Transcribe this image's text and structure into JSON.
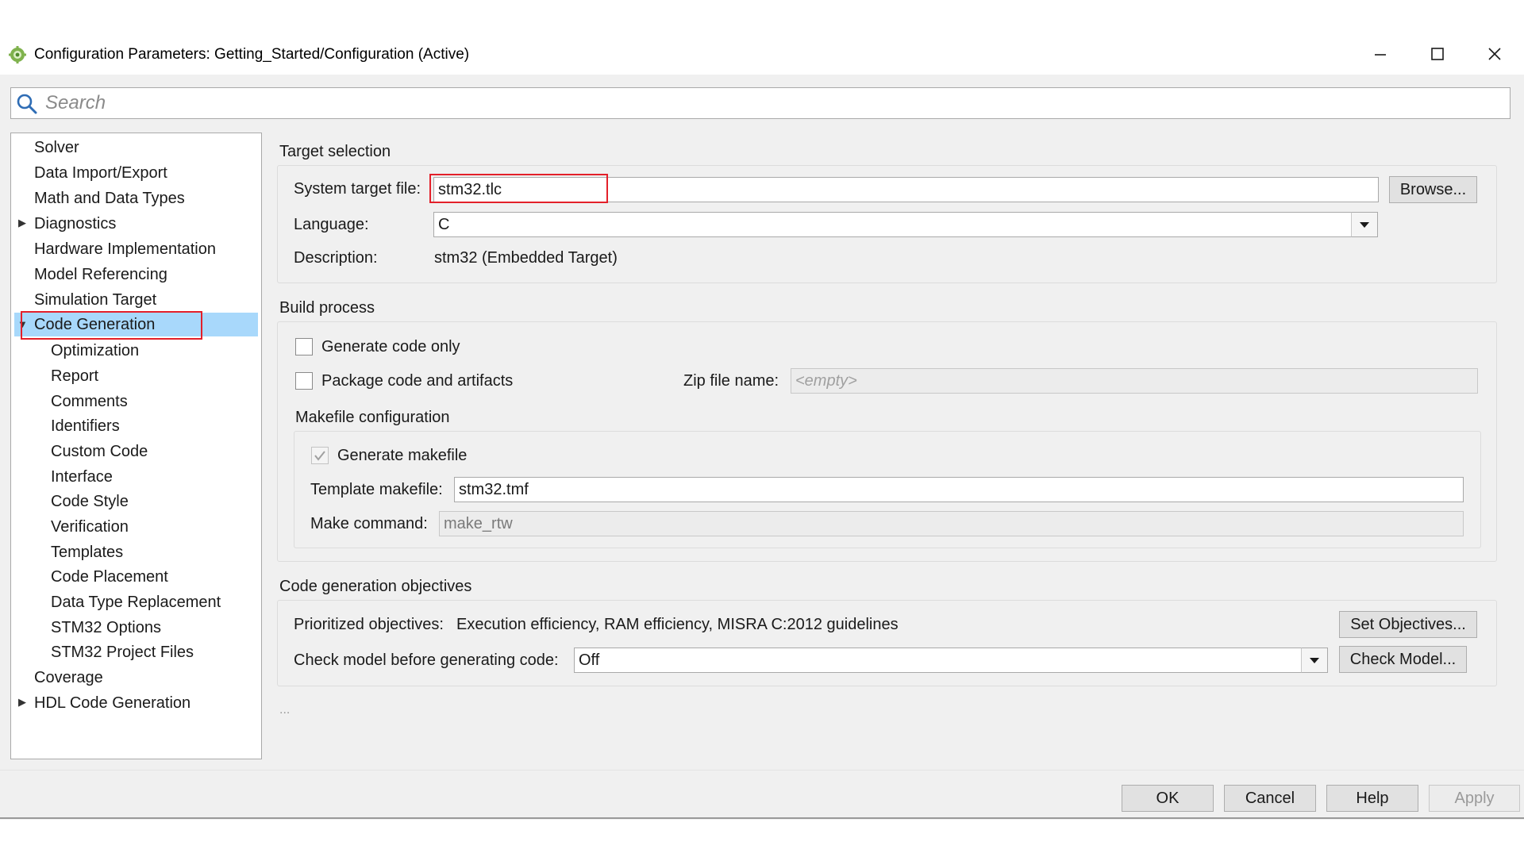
{
  "window": {
    "title": "Configuration Parameters: Getting_Started/Configuration (Active)",
    "icon": "matlab-gear-icon"
  },
  "search": {
    "placeholder": "Search",
    "value": ""
  },
  "tree": {
    "items": [
      {
        "label": "Solver"
      },
      {
        "label": "Data Import/Export"
      },
      {
        "label": "Math and Data Types"
      },
      {
        "label": "Diagnostics",
        "expander": "collapsed"
      },
      {
        "label": "Hardware Implementation"
      },
      {
        "label": "Model Referencing"
      },
      {
        "label": "Simulation Target"
      },
      {
        "label": "Code Generation",
        "expander": "expanded",
        "selected": true
      },
      {
        "label": "Optimization"
      },
      {
        "label": "Report"
      },
      {
        "label": "Comments"
      },
      {
        "label": "Identifiers"
      },
      {
        "label": "Custom Code"
      },
      {
        "label": "Interface"
      },
      {
        "label": "Code Style"
      },
      {
        "label": "Verification"
      },
      {
        "label": "Templates"
      },
      {
        "label": "Code Placement"
      },
      {
        "label": "Data Type Replacement"
      },
      {
        "label": "STM32 Options"
      },
      {
        "label": "STM32 Project Files"
      },
      {
        "label": "Coverage"
      },
      {
        "label": "HDL Code Generation",
        "expander": "collapsed"
      }
    ]
  },
  "target": {
    "section_title": "Target selection",
    "system_target_file_label": "System target file:",
    "system_target_file_value": "stm32.tlc",
    "browse_label": "Browse...",
    "language_label": "Language:",
    "language_value": "C",
    "description_label": "Description:",
    "description_value": "stm32 (Embedded Target)"
  },
  "build": {
    "section_title": "Build process",
    "generate_code_only_label": "Generate code only",
    "generate_code_only_checked": false,
    "package_label": "Package code and artifacts",
    "package_checked": false,
    "zip_label": "Zip file name:",
    "zip_placeholder": "<empty>",
    "makefile": {
      "section_title": "Makefile configuration",
      "generate_makefile_label": "Generate makefile",
      "generate_makefile_checked": true,
      "template_label": "Template makefile:",
      "template_value": "stm32.tmf",
      "make_command_label": "Make command:",
      "make_command_value": "make_rtw"
    }
  },
  "objectives": {
    "section_title": "Code generation objectives",
    "prioritized_label": "Prioritized objectives:",
    "prioritized_value": "Execution efficiency, RAM efficiency, MISRA C:2012 guidelines",
    "set_objectives_label": "Set Objectives...",
    "check_model_label": "Check model before generating code:",
    "check_model_value": "Off",
    "check_model_button": "Check Model..."
  },
  "ellipsis": "...",
  "footer": {
    "ok": "OK",
    "cancel": "Cancel",
    "help": "Help",
    "apply": "Apply"
  },
  "colors": {
    "selection": "#a8d8fb",
    "highlight_box": "#e3202a",
    "panel_bg": "#f0f0f0"
  }
}
